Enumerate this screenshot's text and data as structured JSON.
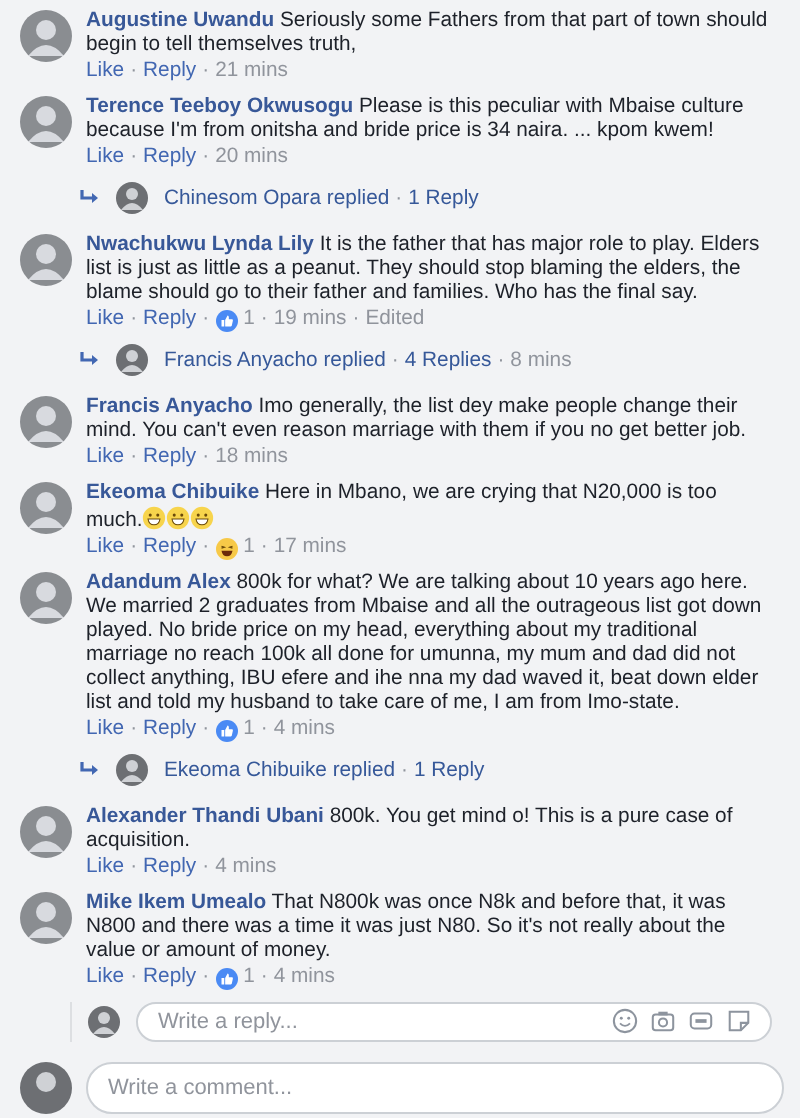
{
  "thread": [
    {
      "kind": "comment",
      "author": "Augustine Uwandu",
      "text": "Seriously some Fathers from that part of town should begin to tell themselves truth,",
      "actions": [
        "Like",
        "Reply"
      ],
      "time": "21 mins"
    },
    {
      "kind": "comment",
      "author": "Terence Teeboy Okwusogu",
      "text": "Please is this peculiar with Mbaise culture because I'm from onitsha and bride price is 34 naira. ... kpom kwem!",
      "actions": [
        "Like",
        "Reply"
      ],
      "time": "20 mins"
    },
    {
      "kind": "replies",
      "author": "Chinesom Opara",
      "verb": "replied",
      "count": "1 Reply"
    },
    {
      "kind": "comment",
      "author": "Nwachukwu Lynda Lily",
      "text": "It is the father that has major role to play. Elders list is just as little as a peanut. They should stop blaming the elders, the blame should go to their father and families. Who has the final say.",
      "actions": [
        "Like",
        "Reply"
      ],
      "reaction": {
        "kind": "like",
        "count": "1"
      },
      "time": "19 mins",
      "edited": "Edited"
    },
    {
      "kind": "replies",
      "author": "Francis Anyacho",
      "verb": "replied",
      "count": "4 Replies",
      "time": "8 mins"
    },
    {
      "kind": "comment",
      "author": "Francis Anyacho",
      "text": "Imo generally, the list dey make people change their mind. You can't even reason marriage with them if you no get better job.",
      "actions": [
        "Like",
        "Reply"
      ],
      "time": "18 mins"
    },
    {
      "kind": "comment",
      "author": "Ekeoma Chibuike",
      "text": "Here in Mbano, we are crying that N20,000 is too much.",
      "emojis": [
        {
          "kind": "grin"
        },
        {
          "kind": "grin"
        },
        {
          "kind": "grin"
        }
      ],
      "actions": [
        "Like",
        "Reply"
      ],
      "reaction": {
        "kind": "haha",
        "count": "1"
      },
      "time": "17 mins"
    },
    {
      "kind": "comment",
      "author": "Adandum Alex",
      "text": "800k for what? We are talking about 10 years ago here. We married 2 graduates from Mbaise and all the outrageous list got down played. No bride price on my head, everything about my traditional marriage no reach 100k all done for umunna, my mum and dad did not collect anything, IBU efere and ihe nna my dad waved it, beat down elder list and told my husband to take care of me, I am from Imo-state.",
      "actions": [
        "Like",
        "Reply"
      ],
      "reaction": {
        "kind": "like",
        "count": "1"
      },
      "time": "4 mins"
    },
    {
      "kind": "replies",
      "author": "Ekeoma Chibuike",
      "verb": "replied",
      "count": "1 Reply"
    },
    {
      "kind": "comment",
      "author": "Alexander Thandi Ubani",
      "text": "800k. You get mind o! This is a pure case of acquisition.",
      "actions": [
        "Like",
        "Reply"
      ],
      "time": "4 mins"
    },
    {
      "kind": "comment",
      "author": "Mike Ikem Umealo",
      "text": "That N800k was once N8k and before that, it was N800 and there was a time it was just N80. So it's not really about the value or amount of money.",
      "actions": [
        "Like",
        "Reply"
      ],
      "reaction": {
        "kind": "like",
        "count": "1"
      },
      "time": "4 mins"
    },
    {
      "kind": "reply_box",
      "placeholder": "Write a reply..."
    }
  ],
  "comment_box": {
    "placeholder": "Write a comment..."
  },
  "separator": "·"
}
